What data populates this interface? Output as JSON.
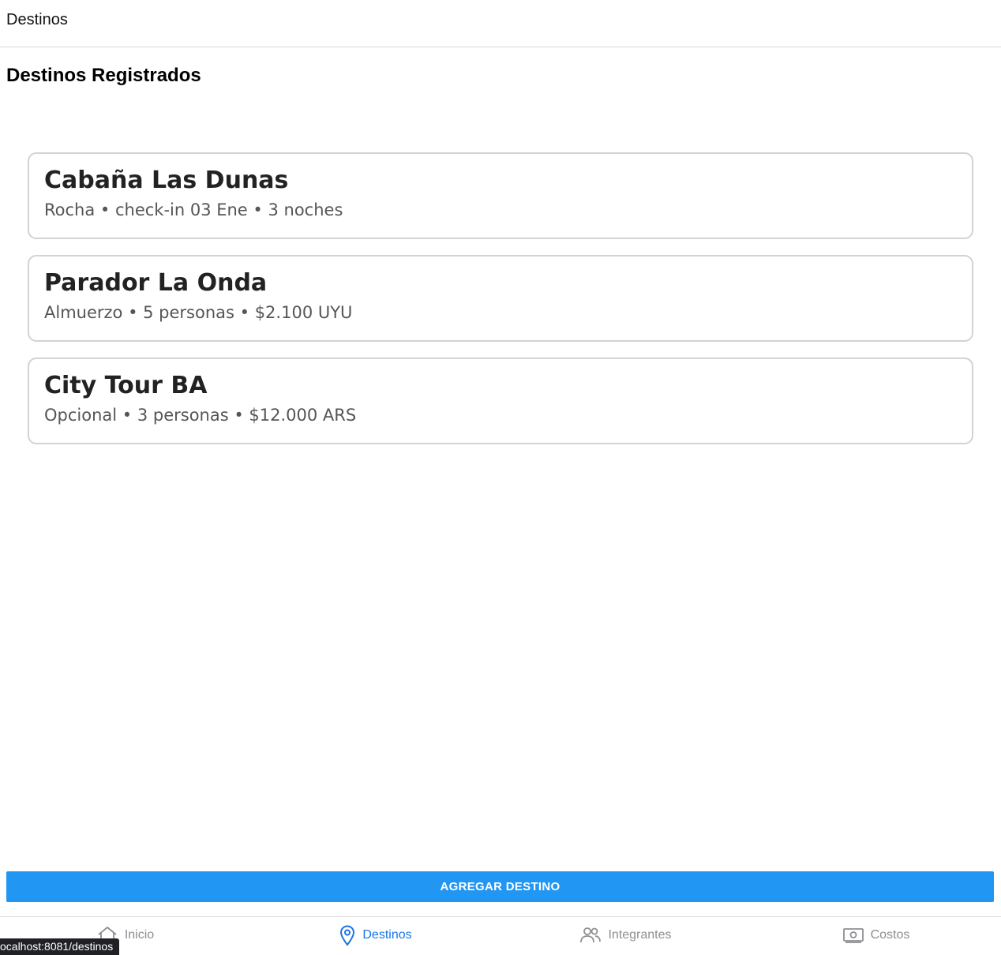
{
  "header": {
    "title": "Destinos"
  },
  "section": {
    "title": "Destinos Registrados"
  },
  "destinations": [
    {
      "name": "Cabaña Las Dunas",
      "details": "Rocha • check-in 03 Ene • 3 noches"
    },
    {
      "name": "Parador La Onda",
      "details": "Almuerzo • 5 personas • $2.100 UYU"
    },
    {
      "name": "City Tour BA",
      "details": "Opcional • 3 personas • $12.000 ARS"
    }
  ],
  "actions": {
    "add_label": "AGREGAR DESTINO"
  },
  "tabs": [
    {
      "label": "Inicio",
      "icon": "home-icon",
      "active": false
    },
    {
      "label": "Destinos",
      "icon": "map-pin-icon",
      "active": true
    },
    {
      "label": "Integrantes",
      "icon": "people-icon",
      "active": false
    },
    {
      "label": "Costos",
      "icon": "money-icon",
      "active": false
    }
  ],
  "status_url": "ocalhost:8081/destinos",
  "colors": {
    "accent": "#2196f3",
    "active_tab": "#1a73e8",
    "inactive_tab": "#8e8e93",
    "card_border": "#d3d3d3"
  }
}
